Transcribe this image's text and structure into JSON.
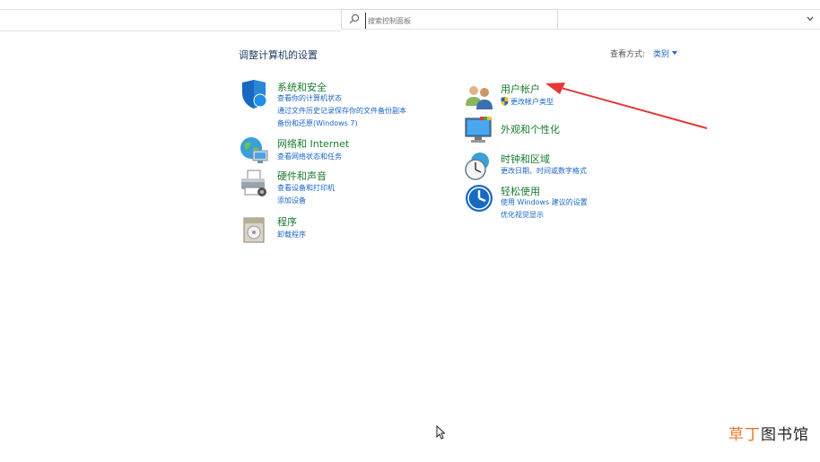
{
  "search": {
    "placeholder": "搜索控制面板"
  },
  "header": {
    "title": "调整计算机的设置",
    "view_by_label": "查看方式:",
    "view_by_value": "类别"
  },
  "categories": {
    "system_security": {
      "title": "系统和安全",
      "links": [
        "查看你的计算机状态",
        "通过文件历史记录保存你的文件备份副本",
        "备份和还原(Windows 7)"
      ]
    },
    "network": {
      "title": "网络和 Internet",
      "links": [
        "查看网络状态和任务"
      ]
    },
    "hardware": {
      "title": "硬件和声音",
      "links": [
        "查看设备和打印机",
        "添加设备"
      ]
    },
    "programs": {
      "title": "程序",
      "links": [
        "卸载程序"
      ]
    },
    "user_accounts": {
      "title": "用户帐户",
      "links": [
        "更改帐户类型"
      ]
    },
    "appearance": {
      "title": "外观和个性化",
      "links": []
    },
    "clock_region": {
      "title": "时钟和区域",
      "links": [
        "更改日期、时间或数字格式"
      ]
    },
    "ease_of_access": {
      "title": "轻松使用",
      "links": [
        "使用 Windows 建议的设置",
        "优化视觉显示"
      ]
    }
  },
  "watermark": {
    "part1": "草丁",
    "part2": "图书馆"
  },
  "colors": {
    "category_title": "#197b2e",
    "link": "#1a66c7",
    "arrow": "#e53935"
  }
}
